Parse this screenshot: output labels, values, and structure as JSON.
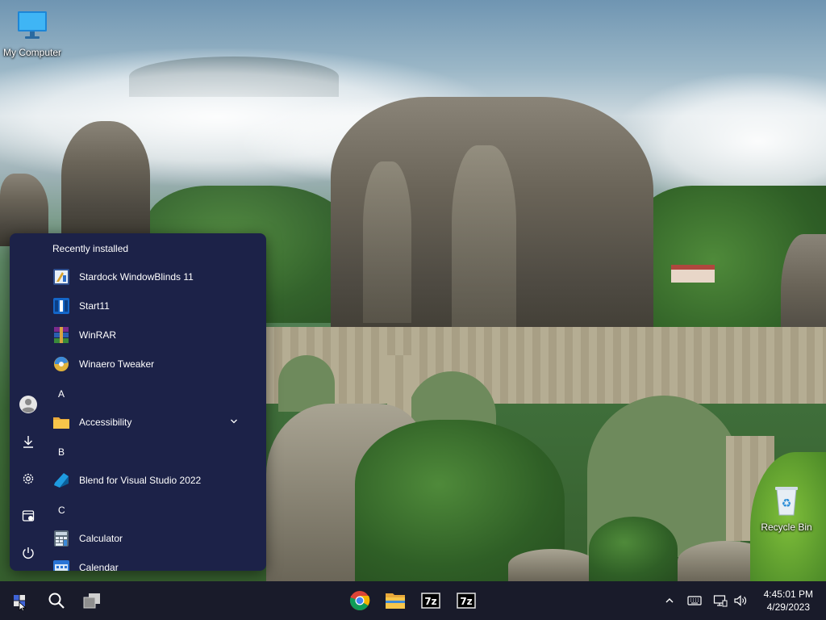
{
  "desktop": {
    "icons": [
      {
        "label": "My Computer",
        "icon": "monitor-icon"
      },
      {
        "label": "Recycle Bin",
        "icon": "recycle-bin-icon"
      }
    ]
  },
  "start_menu": {
    "recent_title": "Recently installed",
    "recent_apps": [
      {
        "label": "Stardock WindowBlinds 11",
        "icon": "windowblinds-icon"
      },
      {
        "label": "Start11",
        "icon": "start11-icon"
      },
      {
        "label": "WinRAR",
        "icon": "winrar-icon"
      },
      {
        "label": "Winaero Tweaker",
        "icon": "winaero-tweaker-icon"
      }
    ],
    "groups": [
      {
        "letter": "A",
        "apps": [
          {
            "label": "Accessibility",
            "icon": "folder-icon",
            "expandable": true
          }
        ]
      },
      {
        "letter": "B",
        "apps": [
          {
            "label": "Blend for Visual Studio 2022",
            "icon": "blend-icon"
          }
        ]
      },
      {
        "letter": "C",
        "apps": [
          {
            "label": "Calculator",
            "icon": "calculator-icon"
          },
          {
            "label": "Calendar",
            "icon": "calendar-icon"
          }
        ]
      }
    ],
    "rail": [
      "user-avatar-icon",
      "downloads-icon",
      "settings-gear-icon",
      "file-explorer-rail-icon",
      "power-icon"
    ]
  },
  "taskbar": {
    "left": [
      "start-button",
      "search-button",
      "task-view-button"
    ],
    "pinned": [
      "chrome-icon",
      "file-explorer-icon",
      "7zip-icon",
      "7zip-icon"
    ],
    "tray": [
      "chevron-up-icon",
      "keyboard-icon",
      "network-icon",
      "volume-icon"
    ],
    "time": "4:45:01 PM",
    "date": "4/29/2023"
  },
  "colors": {
    "start_menu_bg": "#1c2248",
    "taskbar_bg": "#191b2a",
    "accent": "#3f64d8"
  }
}
